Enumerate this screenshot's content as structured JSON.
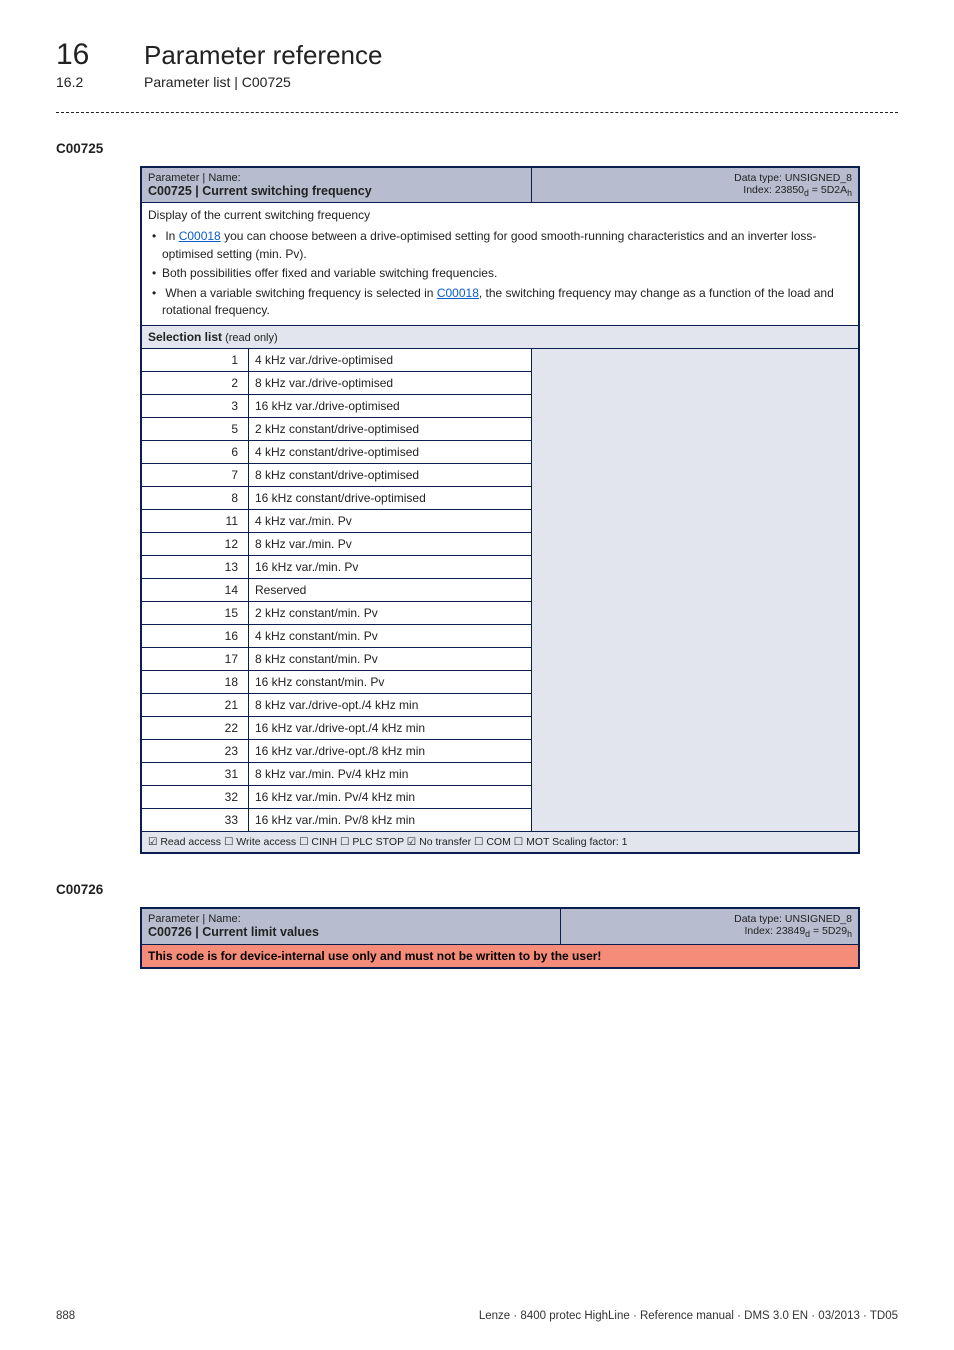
{
  "header": {
    "chapter_number": "16",
    "chapter_title": "Parameter reference",
    "section_number": "16.2",
    "section_title": "Parameter list | C00725"
  },
  "box1": {
    "code_heading": "C00725",
    "hdr_left_label": "Parameter | Name:",
    "hdr_left_value": "C00725 | Current switching frequency",
    "hdr_right_line1": "Data type: UNSIGNED_8",
    "hdr_right_line2": "Index: 23850",
    "hdr_right_line2_sub": "d",
    "hdr_right_line2_eq": " = 5D2A",
    "hdr_right_line2_sub2": "h",
    "desc_line1": "Display of the current switching frequency",
    "desc_link_1": "C00018",
    "desc_bullet_1a": "In ",
    "desc_bullet_1b": " you can choose between a drive-optimised setting for good smooth-running characteristics and an inverter loss-optimised setting (min. Pv).",
    "desc_bullet_2": "Both possibilities offer fixed and variable switching frequencies.",
    "desc_bullet_3a": "When a variable switching frequency is selected in ",
    "desc_link_2": "C00018",
    "desc_bullet_3b": ", the switching frequency may change as a function of the load and rotational frequency.",
    "section_label": "Selection list",
    "section_paren": " (read only)",
    "rows": [
      {
        "n": "1",
        "t": "4 kHz var./drive-optimised"
      },
      {
        "n": "2",
        "t": "8 kHz var./drive-optimised"
      },
      {
        "n": "3",
        "t": "16 kHz var./drive-optimised"
      },
      {
        "n": "5",
        "t": "2 kHz constant/drive-optimised"
      },
      {
        "n": "6",
        "t": "4 kHz constant/drive-optimised"
      },
      {
        "n": "7",
        "t": "8 kHz constant/drive-optimised"
      },
      {
        "n": "8",
        "t": "16 kHz constant/drive-optimised"
      },
      {
        "n": "11",
        "t": "4 kHz var./min. Pv"
      },
      {
        "n": "12",
        "t": "8 kHz var./min. Pv"
      },
      {
        "n": "13",
        "t": "16 kHz var./min. Pv"
      },
      {
        "n": "14",
        "t": "Reserved"
      },
      {
        "n": "15",
        "t": "2 kHz constant/min. Pv"
      },
      {
        "n": "16",
        "t": "4 kHz constant/min. Pv"
      },
      {
        "n": "17",
        "t": "8 kHz constant/min. Pv"
      },
      {
        "n": "18",
        "t": "16 kHz constant/min. Pv"
      },
      {
        "n": "21",
        "t": "8 kHz var./drive-opt./4 kHz min"
      },
      {
        "n": "22",
        "t": "16 kHz var./drive-opt./4 kHz min"
      },
      {
        "n": "23",
        "t": "16 kHz var./drive-opt./8 kHz min"
      },
      {
        "n": "31",
        "t": "8 kHz var./min. Pv/4 kHz min"
      },
      {
        "n": "32",
        "t": "16 kHz var./min. Pv/4 kHz min"
      },
      {
        "n": "33",
        "t": "16 kHz var./min. Pv/8 kHz min"
      }
    ],
    "footer_flags": "☑ Read access   ☐ Write access   ☐ CINH   ☐ PLC STOP   ☑ No transfer   ☐ COM   ☐ MOT    Scaling factor: 1"
  },
  "box2": {
    "code_heading": "C00726",
    "hdr_left_label": "Parameter | Name:",
    "hdr_left_value": "C00726 | Current limit values",
    "hdr_right_line1": "Data type: UNSIGNED_8",
    "hdr_right_line2": "Index: 23849",
    "hdr_right_line2_sub": "d",
    "hdr_right_line2_eq": " = 5D29",
    "hdr_right_line2_sub2": "h",
    "warn_text": "This code is for device-internal use only and must not be written to by the user!"
  },
  "footer": {
    "page_number": "888",
    "doc_info": "Lenze · 8400 protec HighLine · Reference manual · DMS 3.0 EN · 03/2013 · TD05"
  }
}
